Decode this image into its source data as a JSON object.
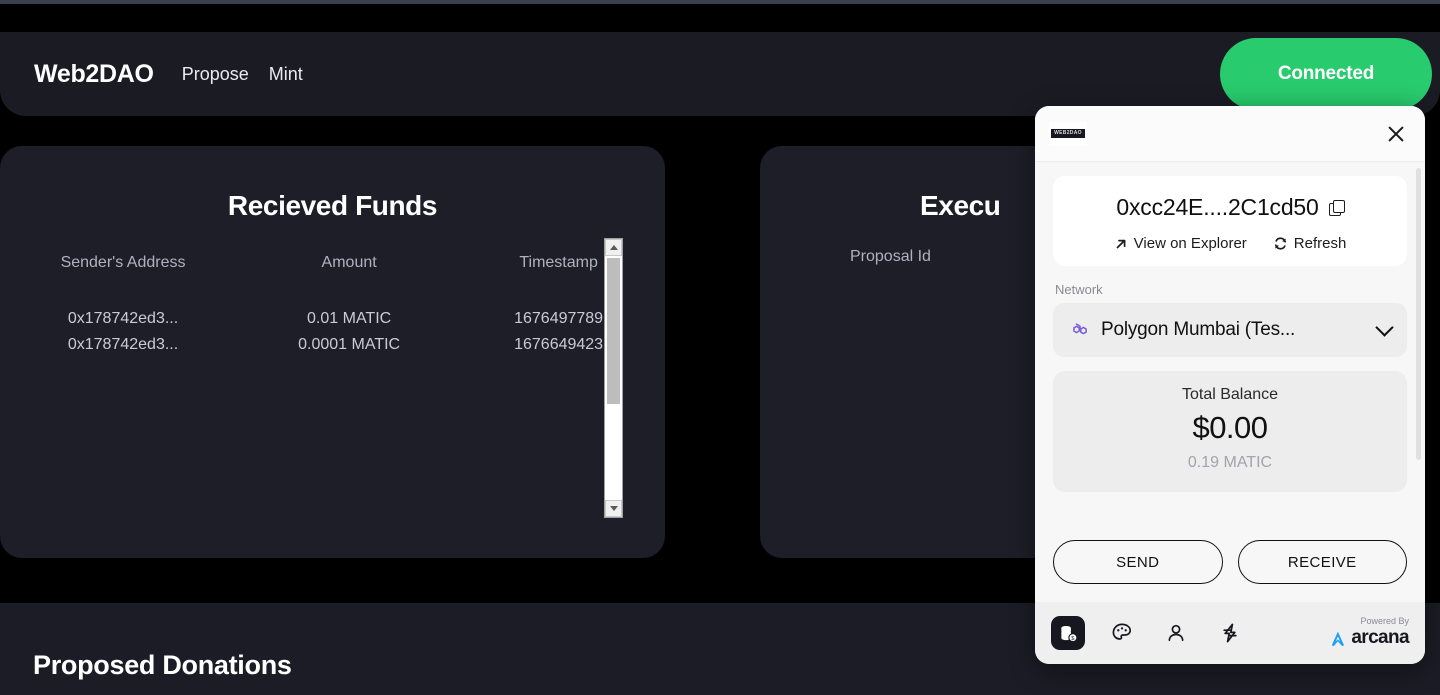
{
  "header": {
    "brand": "Web2DAO",
    "nav": [
      {
        "label": "Propose",
        "name": "nav-propose"
      },
      {
        "label": "Mint",
        "name": "nav-mint"
      }
    ],
    "connect_button": "Connected",
    "connect_color": "#28cb6d"
  },
  "received_funds": {
    "title": "Recieved Funds",
    "columns": [
      "Sender's Address",
      "Amount",
      "Timestamp"
    ],
    "rows": [
      {
        "address": "0x178742ed3...",
        "amount": "0.01 MATIC",
        "timestamp": "1676497789"
      },
      {
        "address": "0x178742ed3...",
        "amount": "0.0001 MATIC",
        "timestamp": "1676649423"
      }
    ]
  },
  "executed": {
    "title": "Execu",
    "columns": [
      "Proposal Id"
    ]
  },
  "proposed_donations": {
    "title": "Proposed Donations"
  },
  "wallet": {
    "logo_text": "WEB2DAO",
    "close_icon": "close-icon",
    "address": "0xcc24E....2C1cd50",
    "copy_icon": "copy-icon",
    "actions": [
      {
        "label": "View on Explorer",
        "icon": "external-link-icon"
      },
      {
        "label": "Refresh",
        "icon": "refresh-icon"
      }
    ],
    "network_label": "Network",
    "network_value": "Polygon Mumbai (Tes...",
    "network_icon_color": "#7b5ce0",
    "balance_label": "Total Balance",
    "balance_value": "$0.00",
    "balance_native": "0.19 MATIC",
    "send_label": "SEND",
    "receive_label": "RECEIVE",
    "footer_icons": [
      {
        "name": "coins-icon",
        "active": true
      },
      {
        "name": "palette-icon",
        "active": false
      },
      {
        "name": "person-icon",
        "active": false
      },
      {
        "name": "lightning-icon",
        "active": false
      }
    ],
    "powered_by": "Powered By",
    "powered_brand": "arcana",
    "powered_brand_color": "#1da1f2"
  }
}
